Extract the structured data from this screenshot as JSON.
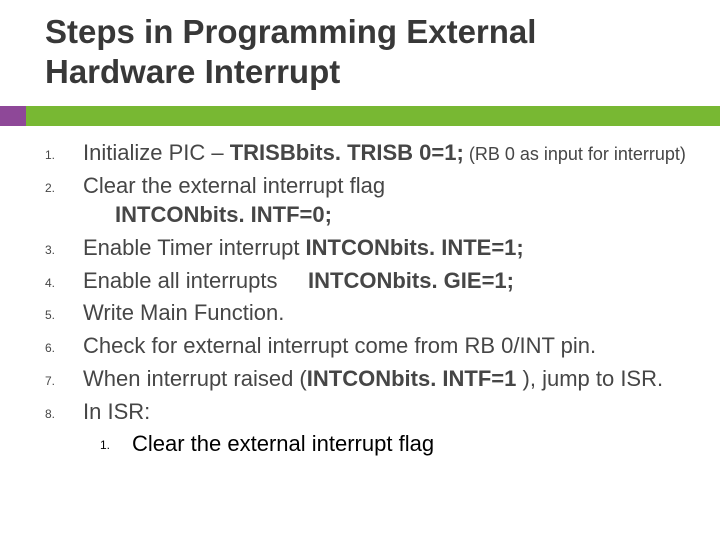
{
  "title": "Steps in Programming External Hardware Interrupt",
  "items": [
    {
      "marker": "1.",
      "main": "Initialize PIC – ",
      "bold": "TRISBbits. TRISB 0=1;",
      "tail_small": " (RB 0 as input for interrupt)"
    },
    {
      "marker": "2.",
      "main": "Clear the external interrupt flag",
      "subline": "INTCONbits. INTF=0;"
    },
    {
      "marker": "3.",
      "main": "Enable Timer interrupt ",
      "bold": "INTCONbits. INTE=1;"
    },
    {
      "marker": "4.",
      "main": "Enable all interrupts     ",
      "bold": "INTCONbits. GIE=1;"
    },
    {
      "marker": "5.",
      "main": "Write Main Function."
    },
    {
      "marker": "6.",
      "main": "Check for external interrupt come from RB 0/INT pin."
    },
    {
      "marker": "7.",
      "main": "When interrupt raised (",
      "bold": "INTCONbits. INTF=1 ",
      "tail": "), jump to ISR."
    },
    {
      "marker": "8.",
      "main": "In ISR:"
    }
  ],
  "sub": {
    "marker": "1.",
    "text": "Clear the external interrupt flag"
  }
}
